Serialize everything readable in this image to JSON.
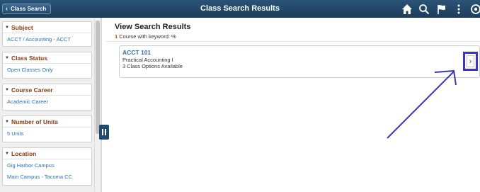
{
  "header": {
    "back_label": "Class Search",
    "title": "Class Search Results",
    "icons": [
      "home-icon",
      "search-icon",
      "flag-icon",
      "more-icon",
      "navbar-icon"
    ]
  },
  "sidebar": {
    "facets": [
      {
        "title": "Subject",
        "items": [
          "ACCT / Accounting - ACCT"
        ]
      },
      {
        "title": "Class Status",
        "items": [
          "Open Classes Only"
        ]
      },
      {
        "title": "Course Career",
        "items": [
          "Academic Career"
        ]
      },
      {
        "title": "Number of Units",
        "items": [
          "5 Units"
        ]
      },
      {
        "title": "Location",
        "items": [
          "Gig Harbor Campus",
          "Main Campus - Tacoma CC"
        ]
      }
    ]
  },
  "results": {
    "title": "View Search Results",
    "count": "1",
    "count_text": "Course with keyword: %",
    "course": {
      "code": "ACCT 101",
      "name": "Practical Accounting I",
      "options": "3 Class Options Available"
    }
  },
  "colors": {
    "header": "#1c3f5e",
    "facet_title": "#8b3a0e",
    "link": "#2a6fb5",
    "annotation": "#3b36b8"
  }
}
